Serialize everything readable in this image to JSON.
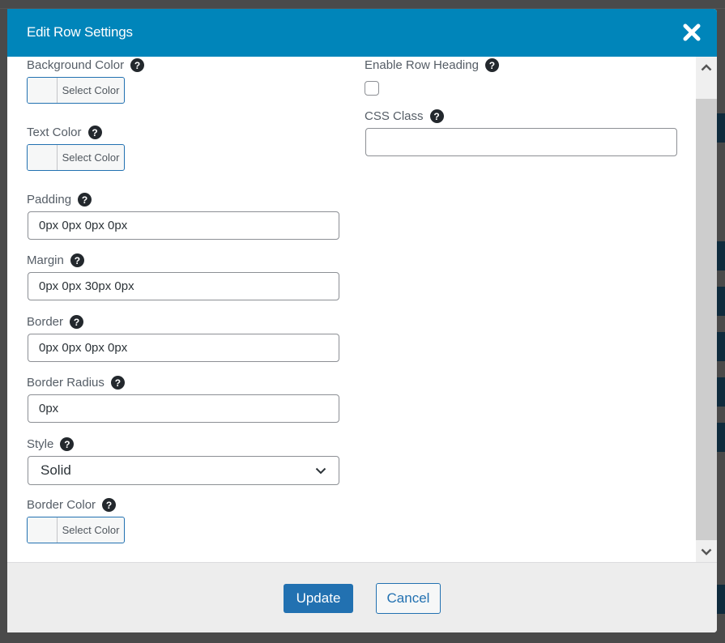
{
  "modal": {
    "title": "Edit Row Settings",
    "close_icon": "close-icon"
  },
  "left_column": {
    "background_color": {
      "label": "Background Color",
      "button": "Select Color"
    },
    "text_color": {
      "label": "Text Color",
      "button": "Select Color"
    },
    "padding": {
      "label": "Padding",
      "value": "0px 0px 0px 0px"
    },
    "margin": {
      "label": "Margin",
      "value": "0px 0px 30px 0px"
    },
    "border": {
      "label": "Border",
      "value": "0px 0px 0px 0px"
    },
    "border_radius": {
      "label": "Border Radius",
      "value": "0px"
    },
    "style": {
      "label": "Style",
      "selected": "Solid"
    },
    "border_color": {
      "label": "Border Color",
      "button": "Select Color"
    }
  },
  "right_column": {
    "enable_row_heading": {
      "label": "Enable Row Heading",
      "checked": false
    },
    "css_class": {
      "label": "CSS Class",
      "value": ""
    }
  },
  "help_glyph": "?",
  "footer": {
    "update_label": "Update",
    "cancel_label": "Cancel"
  },
  "colors": {
    "header": "#0085ba",
    "primary_button": "#2271b1",
    "backdrop": "#4a4a4a"
  }
}
